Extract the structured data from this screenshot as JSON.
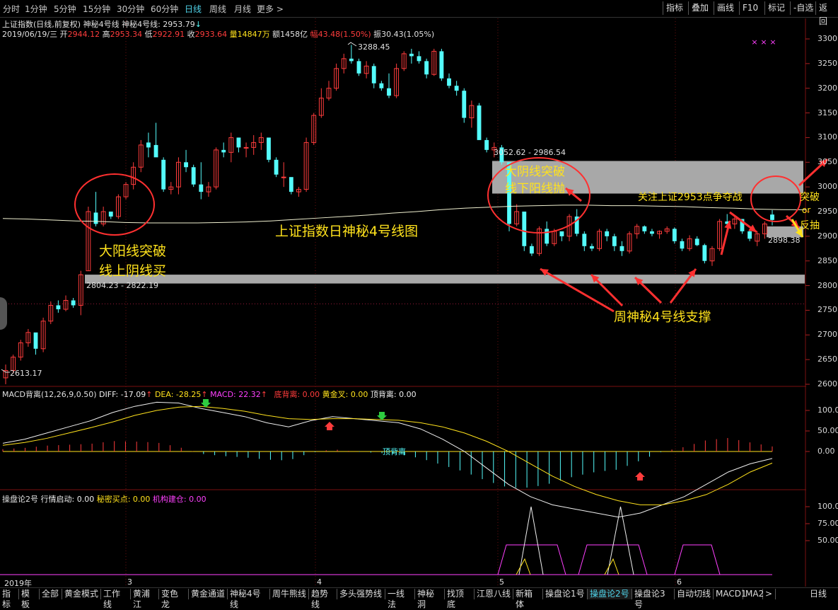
{
  "top_tabs": [
    "分时",
    "1分钟",
    "5分钟",
    "15分钟",
    "30分钟",
    "60分钟",
    "日线",
    "周线",
    "月线",
    "更多 >"
  ],
  "active_tab": "日线",
  "right_buttons": [
    "指标",
    "叠加",
    "画线",
    "F10",
    "标记",
    "-自选",
    "返回"
  ],
  "info": {
    "title": "上证指数(日线,前复权) 神秘4号线  神秘4号线: 2953.79",
    "title_arrow": "↓",
    "date": "2019/06/19/三",
    "open_label": "开",
    "open": "2944.12",
    "high_label": "高",
    "high": "2953.34",
    "low_label": "低",
    "low": "2922.91",
    "close_label": "收",
    "close": "2933.64",
    "vol": "量14847万",
    "amount": "额1458亿",
    "change": "幅43.48(1.50%)",
    "amplitude": "振30.43(1.05%)"
  },
  "macd_info": {
    "name": "MACD背离(12,26,9,0.50)",
    "diff": "DIFF: -17.09",
    "dea": "DEA: -28.25",
    "macd": "MACD: 22.32",
    "bottom_div": "底背离: 0.00",
    "golden": "黄金叉: 0.00",
    "top_div": "顶背离: 0.00",
    "hist_label": "顶背离"
  },
  "ind_info": {
    "name": "操盘论2号",
    "start": "行情启动: 0.00",
    "secret": "秘密买点: 0.00",
    "inst": "机构建仓: 0.00"
  },
  "bottom_tabs": [
    "指标",
    "模板",
    "全部",
    "黄金模式",
    "工作线",
    "黄浦江",
    "变色龙",
    "黄金通道",
    "神秘4号线",
    "周牛熊线",
    "趋势线",
    "多头强势线",
    "一线法",
    "神秘洞",
    "找顶底",
    "江恩八线",
    "新箱体",
    "操盘论1号",
    "操盘论2号",
    "操盘论3号",
    "自动切线",
    "MACD1",
    "MA2",
    ">"
  ],
  "active_bottom_tab": "操盘论2号",
  "bottom_right": "日线",
  "annotations": {
    "title": "上证指数日神秘4号线图",
    "buy1": "大阳线突破",
    "buy2": "线上阴线买",
    "sell1": "大阴线突破",
    "sell2": "线下阳线抛",
    "support": "周神秘4号线支撑",
    "focus": "关注上证2953点争夺战",
    "breakout": "突破",
    "or": "or",
    "pullback": "反抽"
  },
  "price_marks": {
    "high": "3288.45",
    "low": "2613.17",
    "box_upper": "3052.62 - 2986.54",
    "box_lower": "2804.23 - 2822.19",
    "last": "2898.38"
  },
  "colors": {
    "up": "#ff3c3c",
    "down": "#54fcfc",
    "line": "#f0f0d0",
    "band": "#a8a8a8",
    "annotation": "#ffe21c",
    "arrow": "#ff3030"
  },
  "chart_data": [
    {
      "type": "candlestick",
      "title": "上证指数日神秘4号线图",
      "x_ticks": [
        "2019年",
        "3",
        "4",
        "5",
        "6"
      ],
      "y_ticks": [
        2600,
        2650,
        2700,
        2750,
        2800,
        2850,
        2900,
        2950,
        3000,
        3050,
        3100,
        3150,
        3200,
        3250,
        3300
      ],
      "ylim": [
        2580,
        3320
      ],
      "bands": [
        {
          "from": 2804.23,
          "to": 2822.19
        },
        {
          "from": 2986.54,
          "to": 3052.62
        },
        {
          "from": 2898,
          "to": 2920
        }
      ],
      "ohlc": [
        [
          2613,
          2640,
          2600,
          2628
        ],
        [
          2628,
          2660,
          2622,
          2655
        ],
        [
          2655,
          2690,
          2648,
          2684
        ],
        [
          2684,
          2712,
          2676,
          2705
        ],
        [
          2705,
          2702,
          2660,
          2672
        ],
        [
          2672,
          2735,
          2665,
          2728
        ],
        [
          2728,
          2768,
          2722,
          2760
        ],
        [
          2760,
          2770,
          2745,
          2752
        ],
        [
          2752,
          2780,
          2748,
          2770
        ],
        [
          2770,
          2775,
          2755,
          2760
        ],
        [
          2760,
          2830,
          2740,
          2822
        ],
        [
          2830,
          2960,
          2830,
          2950
        ],
        [
          2948,
          2990,
          2920,
          2925
        ],
        [
          2925,
          2960,
          2920,
          2950
        ],
        [
          2950,
          2945,
          2935,
          2940
        ],
        [
          2940,
          2985,
          2935,
          2980
        ],
        [
          2980,
          3010,
          2975,
          3005
        ],
        [
          3005,
          3050,
          2995,
          3040
        ],
        [
          3040,
          3095,
          3030,
          3085
        ],
        [
          3090,
          3110,
          3060,
          3080
        ],
        [
          3085,
          3130,
          3080,
          3060
        ],
        [
          3055,
          3060,
          2990,
          2995
        ],
        [
          2995,
          3010,
          2985,
          3000
        ],
        [
          3000,
          3060,
          2985,
          3050
        ],
        [
          3050,
          3075,
          3030,
          3040
        ],
        [
          3040,
          3045,
          3000,
          3005
        ],
        [
          3005,
          3050,
          2975,
          2990
        ],
        [
          2990,
          3010,
          2980,
          3000
        ],
        [
          3000,
          3080,
          2995,
          3075
        ],
        [
          3075,
          3090,
          3060,
          3070
        ],
        [
          3070,
          3110,
          3050,
          3100
        ],
        [
          3100,
          3100,
          3070,
          3080
        ],
        [
          3080,
          3090,
          3060,
          3080
        ],
        [
          3080,
          3105,
          3065,
          3090
        ],
        [
          3090,
          3110,
          3075,
          3100
        ],
        [
          3100,
          3100,
          3050,
          3055
        ],
        [
          3055,
          3060,
          3020,
          3025
        ],
        [
          3020,
          3050,
          3000,
          3020
        ],
        [
          3020,
          3010,
          2985,
          2990
        ],
        [
          2990,
          3000,
          2980,
          2995
        ],
        [
          2995,
          3100,
          2990,
          3090
        ],
        [
          3090,
          3150,
          3085,
          3145
        ],
        [
          3145,
          3200,
          3140,
          3180
        ],
        [
          3180,
          3215,
          3175,
          3200
        ],
        [
          3200,
          3250,
          3195,
          3240
        ],
        [
          3240,
          3270,
          3230,
          3260
        ],
        [
          3260,
          3288,
          3250,
          3255
        ],
        [
          3255,
          3260,
          3225,
          3230
        ],
        [
          3230,
          3255,
          3220,
          3245
        ],
        [
          3245,
          3250,
          3200,
          3210
        ],
        [
          3210,
          3215,
          3195,
          3200
        ],
        [
          3200,
          3230,
          3180,
          3185
        ],
        [
          3185,
          3250,
          3180,
          3240
        ],
        [
          3240,
          3275,
          3235,
          3270
        ],
        [
          3270,
          3280,
          3250,
          3265
        ],
        [
          3265,
          3275,
          3250,
          3255
        ],
        [
          3255,
          3260,
          3220,
          3228
        ],
        [
          3228,
          3280,
          3225,
          3275
        ],
        [
          3275,
          3280,
          3215,
          3220
        ],
        [
          3220,
          3230,
          3200,
          3205
        ],
        [
          3205,
          3215,
          3185,
          3195
        ],
        [
          3195,
          3200,
          3130,
          3140
        ],
        [
          3140,
          3175,
          3120,
          3165
        ],
        [
          3165,
          3170,
          3100,
          3095
        ],
        [
          3095,
          3100,
          3070,
          3075
        ],
        [
          3075,
          3090,
          3060,
          3080
        ],
        [
          3080,
          3085,
          3045,
          3050
        ],
        [
          3050,
          3035,
          2910,
          2925
        ],
        [
          2925,
          2965,
          2920,
          2950
        ],
        [
          2950,
          2940,
          2870,
          2880
        ],
        [
          2880,
          2885,
          2860,
          2865
        ],
        [
          2865,
          2920,
          2860,
          2915
        ],
        [
          2915,
          2930,
          2880,
          2885
        ],
        [
          2885,
          2915,
          2880,
          2910
        ],
        [
          2910,
          2905,
          2890,
          2900
        ],
        [
          2900,
          2945,
          2890,
          2940
        ],
        [
          2940,
          2955,
          2900,
          2905
        ],
        [
          2905,
          2910,
          2870,
          2880
        ],
        [
          2880,
          2885,
          2870,
          2875
        ],
        [
          2875,
          2915,
          2870,
          2910
        ],
        [
          2910,
          2915,
          2890,
          2900
        ],
        [
          2900,
          2905,
          2870,
          2880
        ],
        [
          2880,
          2890,
          2860,
          2870
        ],
        [
          2870,
          2910,
          2865,
          2905
        ],
        [
          2905,
          2925,
          2895,
          2920
        ],
        [
          2920,
          2922,
          2905,
          2910
        ],
        [
          2910,
          2915,
          2900,
          2905
        ],
        [
          2905,
          2912,
          2895,
          2910
        ],
        [
          2910,
          2920,
          2905,
          2915
        ],
        [
          2915,
          2918,
          2885,
          2890
        ],
        [
          2890,
          2895,
          2870,
          2875
        ],
        [
          2875,
          2902,
          2870,
          2895
        ],
        [
          2895,
          2900,
          2880,
          2882
        ],
        [
          2882,
          2885,
          2845,
          2850
        ],
        [
          2850,
          2880,
          2840,
          2875
        ],
        [
          2875,
          2935,
          2870,
          2930
        ],
        [
          2930,
          2945,
          2920,
          2925
        ],
        [
          2925,
          2940,
          2915,
          2935
        ],
        [
          2935,
          2930,
          2905,
          2910
        ],
        [
          2910,
          2912,
          2890,
          2895
        ],
        [
          2890,
          2910,
          2880,
          2905
        ],
        [
          2905,
          2930,
          2895,
          2925
        ],
        [
          2944,
          2953,
          2922,
          2933
        ]
      ],
      "ma_line": [
        2936,
        2935,
        2933,
        2931,
        2930,
        2928,
        2927,
        2927,
        2927,
        2928,
        2929,
        2931,
        2934,
        2937,
        2940,
        2943,
        2947,
        2950,
        2954,
        2957,
        2959,
        2961,
        2962,
        2963,
        2963,
        2962,
        2962,
        2961,
        2960,
        2958,
        2957,
        2955,
        2954,
        2953.79
      ]
    },
    {
      "type": "macd",
      "series": [
        {
          "name": "DIFF",
          "values": [
            20,
            30,
            45,
            60,
            75,
            95,
            110,
            120,
            118,
            105,
            95,
            85,
            70,
            60,
            75,
            85,
            80,
            75,
            70,
            55,
            30,
            0,
            -40,
            -80,
            -110,
            -130,
            -140,
            -150,
            -160,
            -150,
            -130,
            -110,
            -80,
            -50,
            -30,
            -17.09
          ]
        },
        {
          "name": "DEA",
          "values": [
            15,
            22,
            32,
            45,
            58,
            72,
            88,
            100,
            108,
            110,
            105,
            98,
            88,
            80,
            78,
            80,
            80,
            78,
            76,
            70,
            60,
            45,
            25,
            0,
            -30,
            -60,
            -85,
            -105,
            -120,
            -130,
            -130,
            -120,
            -105,
            -80,
            -50,
            -28.25
          ]
        }
      ],
      "ylim": [
        -200,
        140
      ],
      "y_ticks": [
        0,
        50,
        100
      ]
    },
    {
      "type": "line",
      "name": "操盘论2号",
      "ylim": [
        0,
        125
      ],
      "y_ticks": [
        50,
        75,
        100
      ]
    }
  ]
}
